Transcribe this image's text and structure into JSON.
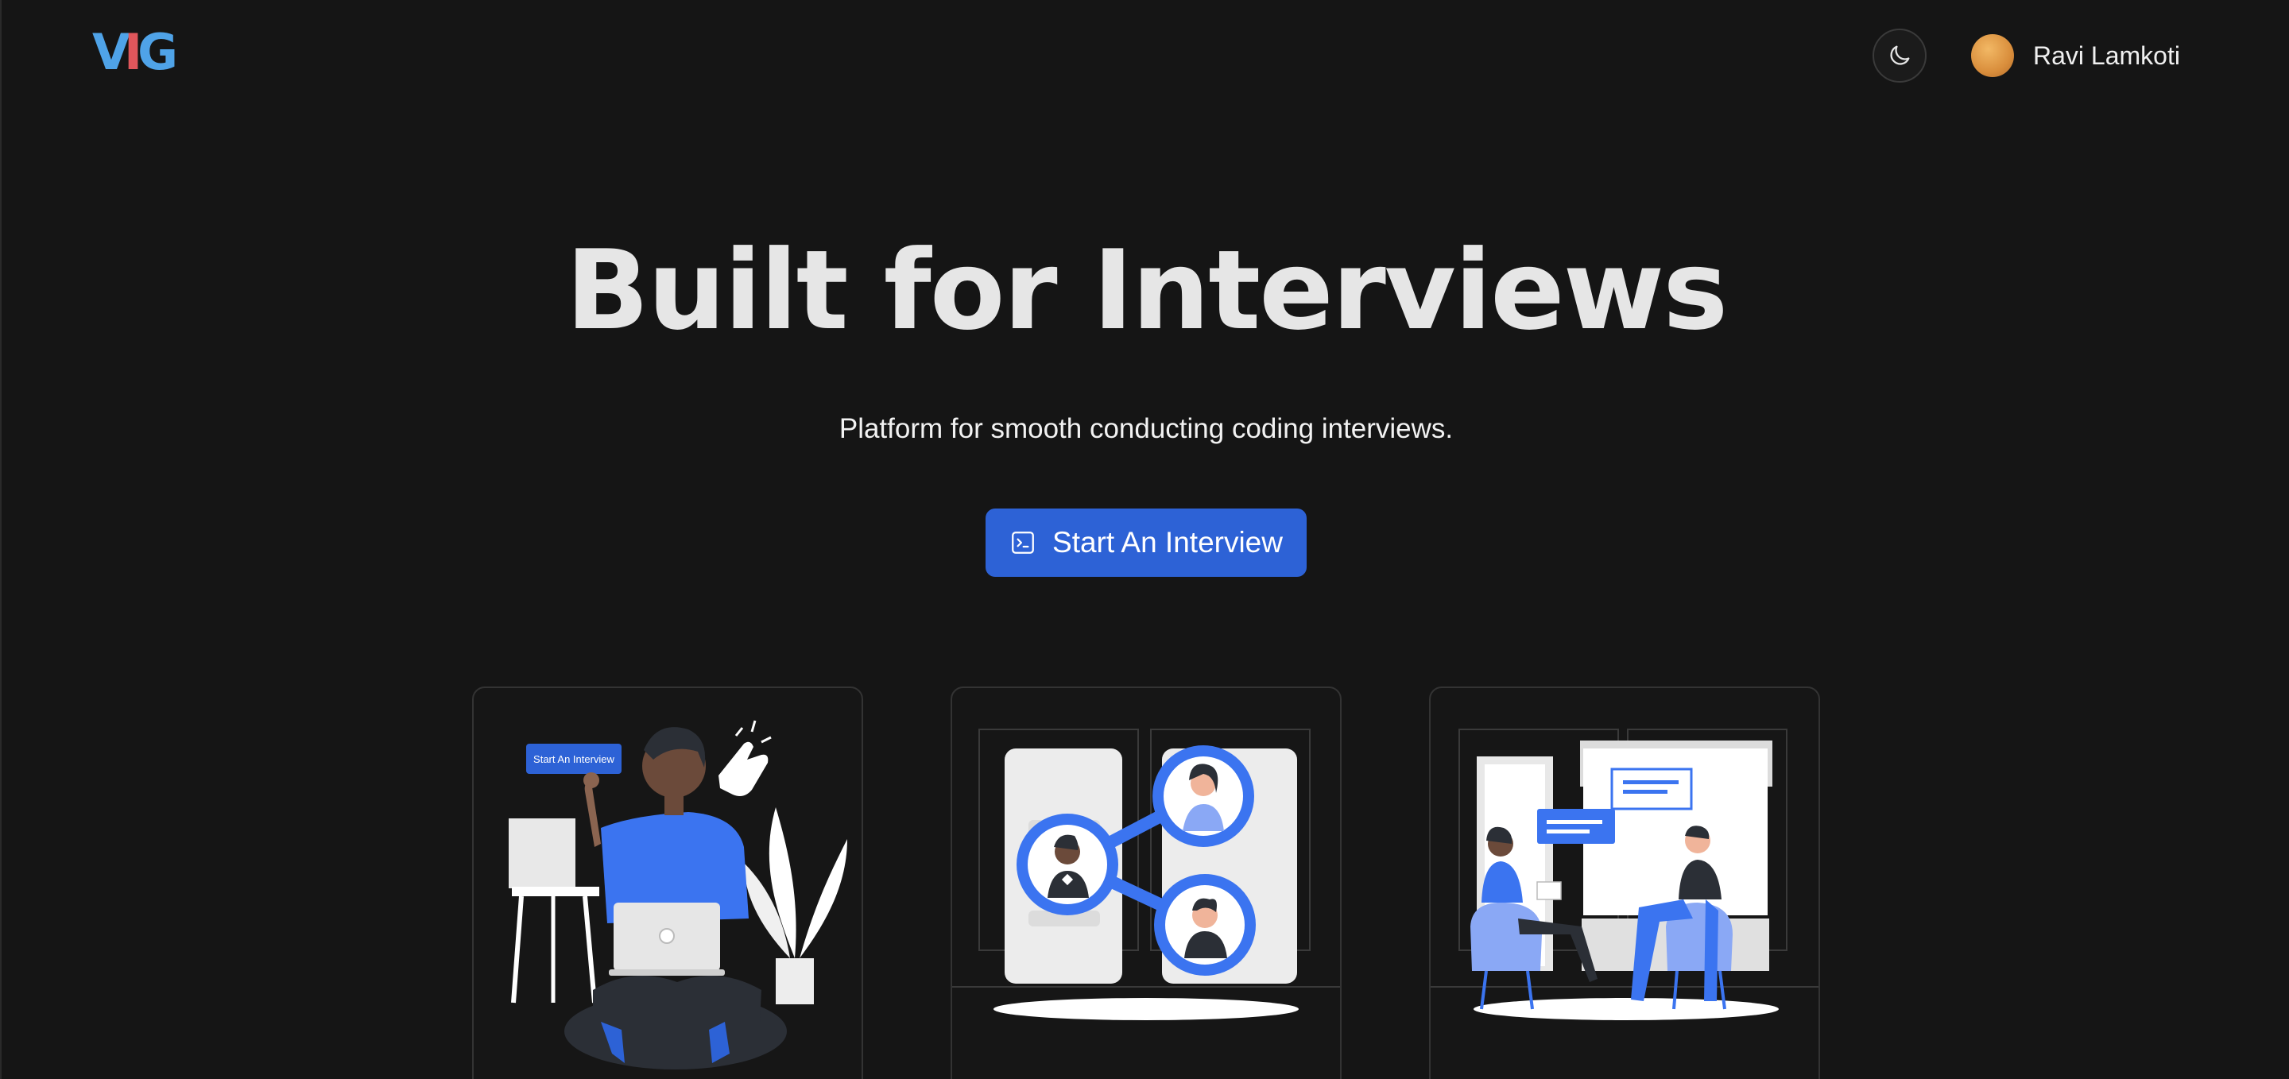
{
  "header": {
    "logo": {
      "v": "V",
      "i": "I",
      "g": "G"
    },
    "theme_toggle_icon": "moon-icon",
    "user": {
      "name": "Ravi Lamkoti",
      "avatar_icon": "avatar"
    }
  },
  "hero": {
    "title": "Built for Interviews",
    "subtitle": "Platform for smooth conducting coding interviews.",
    "cta": {
      "label": "Start An Interview",
      "icon": "terminal-icon"
    }
  },
  "cards": [
    {
      "illustration": "person-with-laptop-illustration",
      "button_label": "Start An Interview"
    },
    {
      "illustration": "video-call-participants-illustration"
    },
    {
      "illustration": "interview-meeting-illustration"
    }
  ],
  "colors": {
    "background": "#151515",
    "accent": "#2d62d6",
    "illustration_blue": "#3b74f0",
    "logo_blue": "#4fa3e8",
    "logo_red": "#e0565b"
  }
}
